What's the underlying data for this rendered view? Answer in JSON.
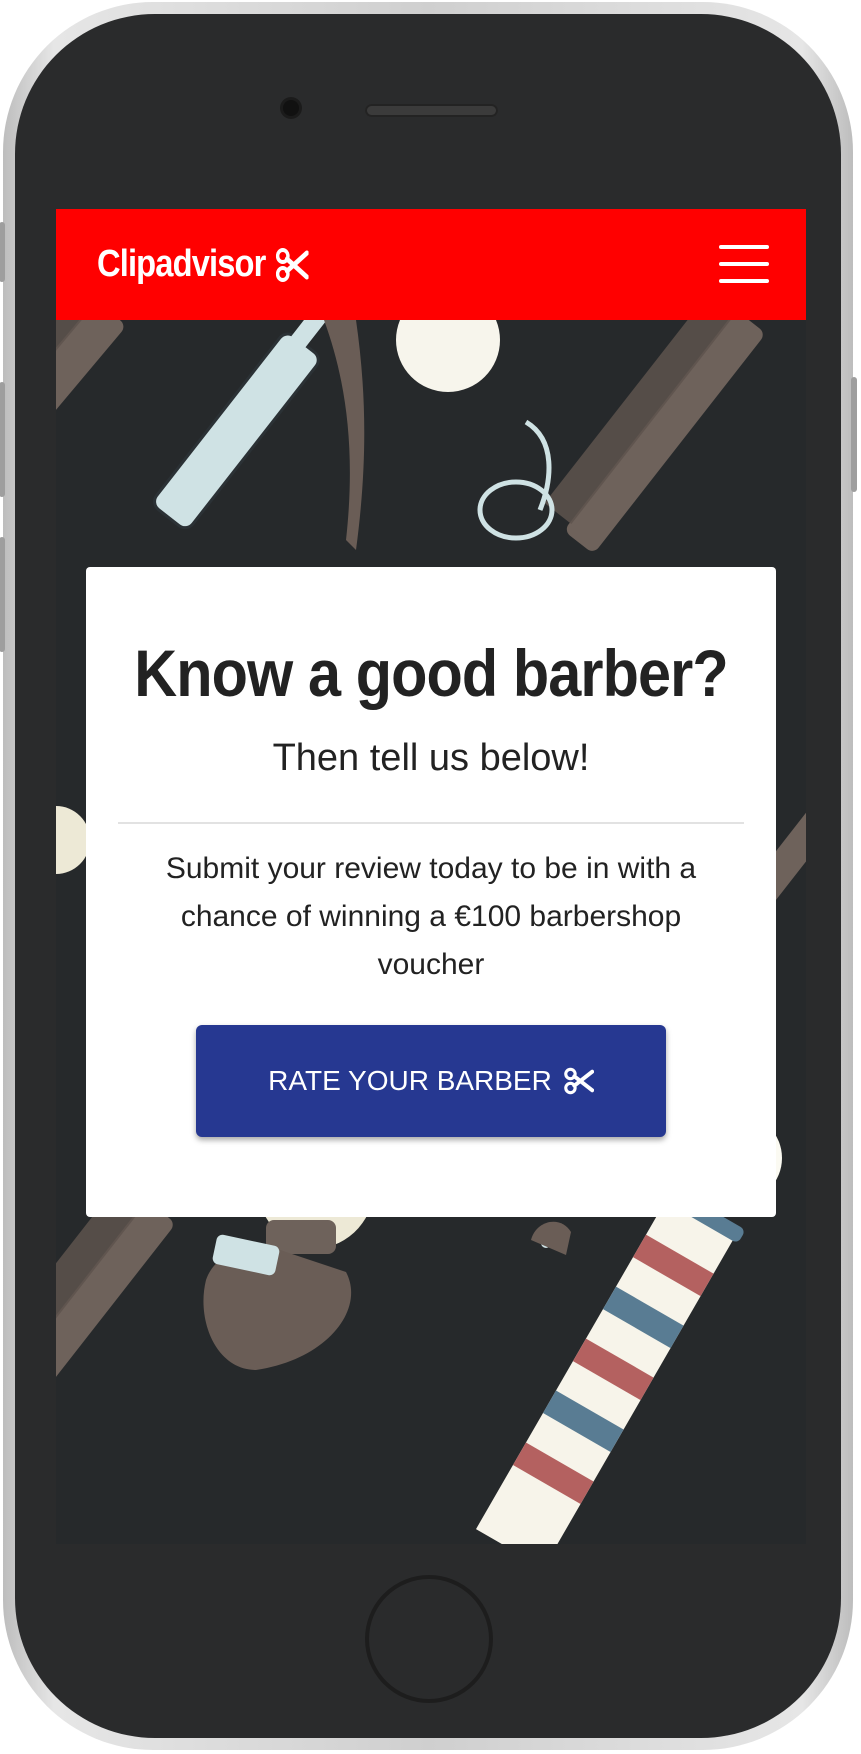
{
  "navbar": {
    "brand": "Clipadvisor",
    "brand_icon": "scissors-icon",
    "menu_icon": "hamburger-menu-icon",
    "background_color": "#ff0000"
  },
  "hero": {
    "title": "Know a good barber?",
    "subtitle": "Then tell us below!",
    "body": "Submit your review today to be in with a chance of winning a €100 barbershop voucher",
    "cta_label": "RATE YOUR BARBER",
    "cta_icon": "scissors-icon",
    "cta_color": "#263891"
  },
  "background": {
    "illustrations": [
      "comb",
      "straight-razor",
      "shaving-brush",
      "scissors",
      "barber-pole"
    ],
    "color": "#26292b"
  }
}
